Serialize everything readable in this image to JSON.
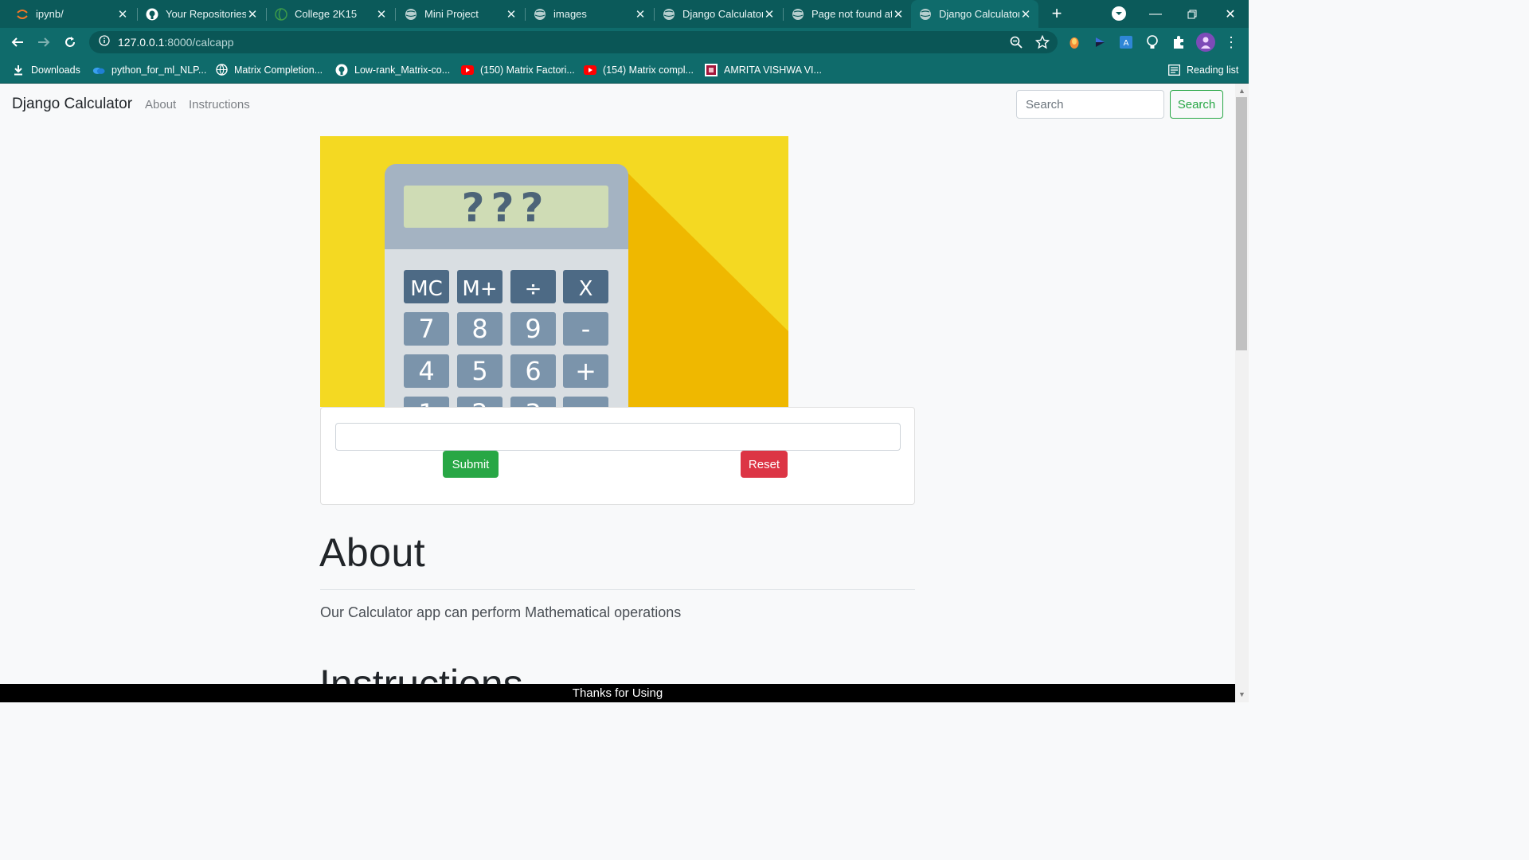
{
  "browser": {
    "tabs": [
      {
        "title": "ipynb/",
        "icon": "jupyter-icon"
      },
      {
        "title": "Your Repositories",
        "icon": "github-icon"
      },
      {
        "title": "College 2K15",
        "icon": "college-icon"
      },
      {
        "title": "Mini Project",
        "icon": "globe-icon"
      },
      {
        "title": "images",
        "icon": "globe-icon"
      },
      {
        "title": "Django Calculator",
        "icon": "globe-icon"
      },
      {
        "title": "Page not found at",
        "icon": "globe-icon"
      },
      {
        "title": "Django Calculator",
        "icon": "globe-icon",
        "active": true
      }
    ],
    "address": {
      "host": "127.0.0.1",
      "path": ":8000/calcapp"
    },
    "bookmarks": [
      {
        "label": "Downloads",
        "icon": "download-icon"
      },
      {
        "label": "python_for_ml_NLP...",
        "icon": "onedrive-icon"
      },
      {
        "label": "Matrix Completion...",
        "icon": "globe-icon"
      },
      {
        "label": "Low-rank_Matrix-co...",
        "icon": "github-icon"
      },
      {
        "label": "(150) Matrix Factori...",
        "icon": "youtube-icon"
      },
      {
        "label": "(154) Matrix compl...",
        "icon": "youtube-icon"
      },
      {
        "label": "AMRITA VISHWA VI...",
        "icon": "amrita-icon"
      }
    ],
    "reading_list_label": "Reading list",
    "colors": {
      "frame": "#0b5a5a",
      "toolbar": "#0f6b6b"
    }
  },
  "navbar": {
    "brand": "Django Calculator",
    "links": [
      "About",
      "Instructions"
    ],
    "search_placeholder": "Search",
    "search_button": "Search"
  },
  "hero": {
    "display_text": "???",
    "keys": [
      [
        "MC",
        "M+",
        "÷",
        "X"
      ],
      [
        "7",
        "8",
        "9",
        "-"
      ],
      [
        "4",
        "5",
        "6",
        "+"
      ],
      [
        "1",
        "2",
        "3",
        "="
      ]
    ]
  },
  "calculator": {
    "input_value": "",
    "submit_label": "Submit",
    "reset_label": "Reset",
    "colors": {
      "submit": "#28a745",
      "reset": "#dc3545"
    }
  },
  "about": {
    "heading": "About",
    "text": "Our Calculator app can perform Mathematical operations"
  },
  "instructions": {
    "heading": "Instructions"
  },
  "footer": {
    "text": "Thanks for Using"
  }
}
